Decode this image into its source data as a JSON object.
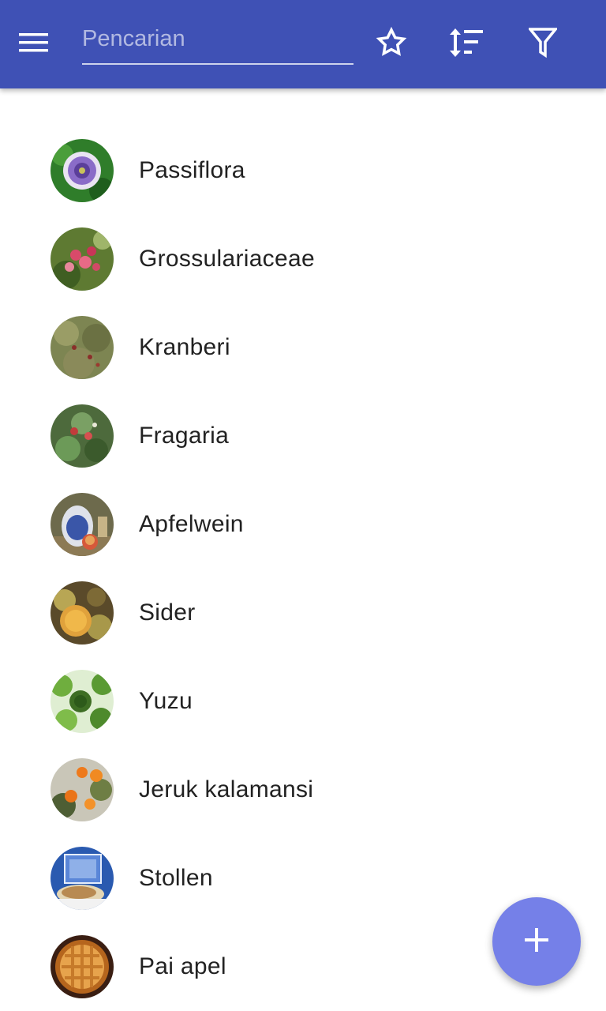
{
  "toolbar": {
    "menu_icon": "hamburger-menu-icon",
    "search_placeholder": "Pencarian",
    "search_value": "",
    "favorites_icon": "star-outline-icon",
    "sort_icon": "sort-icon",
    "filter_icon": "filter-icon",
    "background_color": "#3f51b5"
  },
  "list": {
    "items": [
      {
        "label": "Passiflora"
      },
      {
        "label": "Grossulariaceae"
      },
      {
        "label": "Kranberi"
      },
      {
        "label": "Fragaria"
      },
      {
        "label": "Apfelwein"
      },
      {
        "label": "Sider"
      },
      {
        "label": "Yuzu"
      },
      {
        "label": "Jeruk kalamansi"
      },
      {
        "label": "Stollen"
      },
      {
        "label": "Pai apel"
      }
    ]
  },
  "fab": {
    "icon": "plus-icon",
    "color": "#7580e8"
  }
}
